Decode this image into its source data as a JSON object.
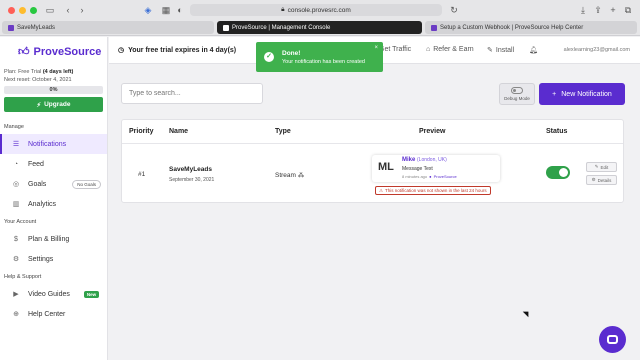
{
  "browser": {
    "url": "console.provesrc.com",
    "tabs": [
      {
        "label": "SaveMyLeads"
      },
      {
        "label": "ProveSource | Management Console"
      },
      {
        "label": "Setup a Custom Webhook | ProveSource Help Center"
      }
    ]
  },
  "sidebar": {
    "logo": "ProveSource",
    "plan_prefix": "Plan: Free Trial ",
    "plan_days": "(4 days left)",
    "next_reset": "Next reset: October 4, 2021",
    "usage": "0%",
    "usage_fraction": 0,
    "upgrade": "Upgrade",
    "section_manage": "Manage",
    "items_manage": [
      {
        "label": "Notifications",
        "icon": "list-icon"
      },
      {
        "label": "Feed",
        "icon": "rss-icon"
      },
      {
        "label": "Goals",
        "icon": "target-icon",
        "badge": "No Goals"
      },
      {
        "label": "Analytics",
        "icon": "chart-icon"
      }
    ],
    "section_account": "Your Account",
    "items_account": [
      {
        "label": "Plan & Billing",
        "icon": "dollar-icon"
      },
      {
        "label": "Settings",
        "icon": "gear-icon"
      }
    ],
    "section_help": "Help & Support",
    "items_help": [
      {
        "label": "Video Guides",
        "icon": "video-icon",
        "badge": "New"
      },
      {
        "label": "Help Center",
        "icon": "lifebuoy-icon"
      }
    ]
  },
  "topbar": {
    "trial": "Your free trial expires in 4 day(s)",
    "get_traffic": "Get Traffic",
    "refer": "Refer & Earn",
    "install": "Install",
    "email": "alexlearning23@gmail.com"
  },
  "toast": {
    "title": "Done!",
    "message": "Your notification has been created"
  },
  "main": {
    "search_placeholder": "Type to search...",
    "debug_label": "Debug Mode",
    "new_notification": "New Notification",
    "columns": [
      "Priority",
      "Name",
      "Type",
      "Preview",
      "Status"
    ],
    "row": {
      "priority": "#1",
      "name": "SaveMyLeads",
      "date": "September 30, 2021",
      "type": "Stream",
      "preview_initials": "ML",
      "preview_name": "Mike",
      "preview_location": "(London, UK)",
      "preview_message": "Message Text",
      "preview_time": "8 minutes ago",
      "preview_brand": "ProveSource",
      "warning": "This notification was not shown in the last 24 hours",
      "edit": "Edit",
      "details": "Details",
      "active": true
    }
  },
  "colors": {
    "brand": "#5a2ccf",
    "success": "#2fa14a",
    "warning": "#c0392b"
  }
}
